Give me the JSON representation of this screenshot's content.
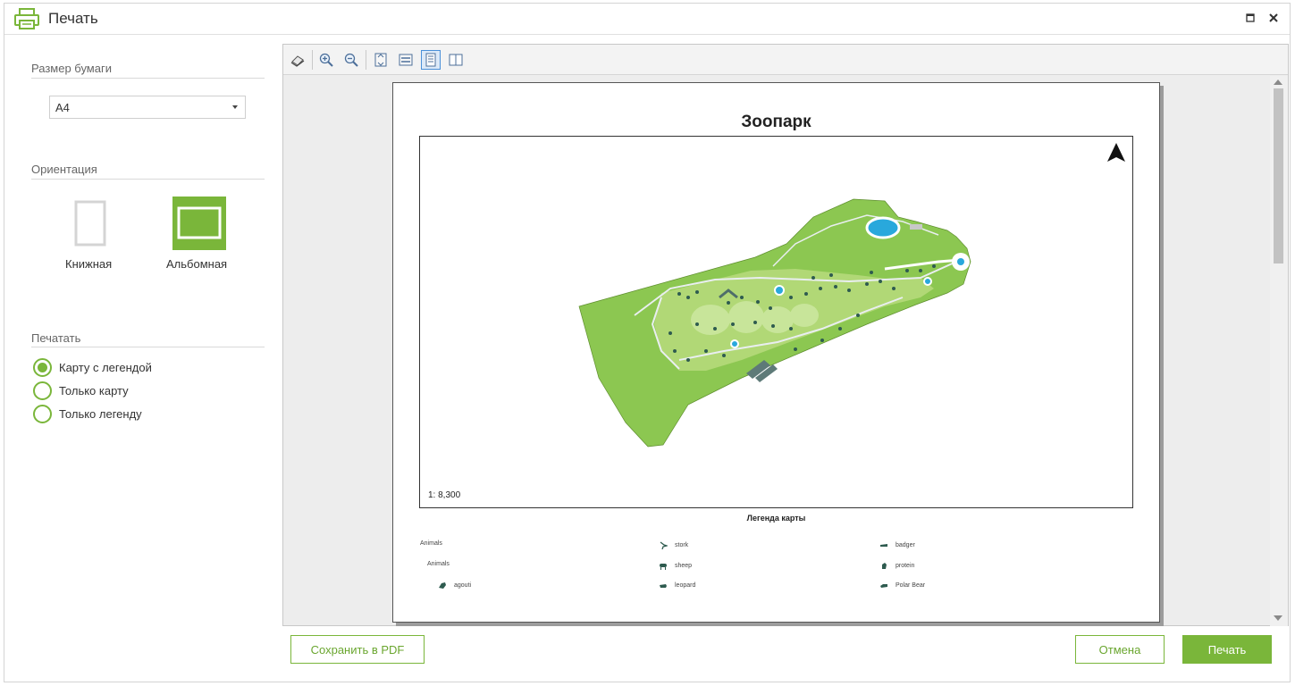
{
  "window": {
    "title": "Печать"
  },
  "paper": {
    "section_title": "Размер бумаги",
    "selected": "A4"
  },
  "orientation": {
    "section_title": "Ориентация",
    "portrait_label": "Книжная",
    "landscape_label": "Альбомная",
    "selected": "landscape"
  },
  "print": {
    "section_title": "Печатать",
    "options": [
      {
        "label": "Карту с легендой",
        "checked": true
      },
      {
        "label": "Только карту",
        "checked": false
      },
      {
        "label": "Только легенду",
        "checked": false
      }
    ]
  },
  "preview": {
    "page_title": "Зоопарк",
    "scale": "1: 8,300",
    "legend_title": "Легенда карты",
    "legend": {
      "col1": [
        "Animals",
        "Animals",
        "agouti"
      ],
      "col2": [
        "stork",
        "sheep",
        "leopard"
      ],
      "col3": [
        "badger",
        "protein",
        "Polar Bear"
      ]
    }
  },
  "buttons": {
    "save_pdf": "Сохранить в PDF",
    "cancel": "Отмена",
    "print": "Печать"
  },
  "colors": {
    "accent": "#7ab63a",
    "map_green": "#8cc751",
    "map_light": "#c3e08b",
    "water": "#29a8dc"
  }
}
